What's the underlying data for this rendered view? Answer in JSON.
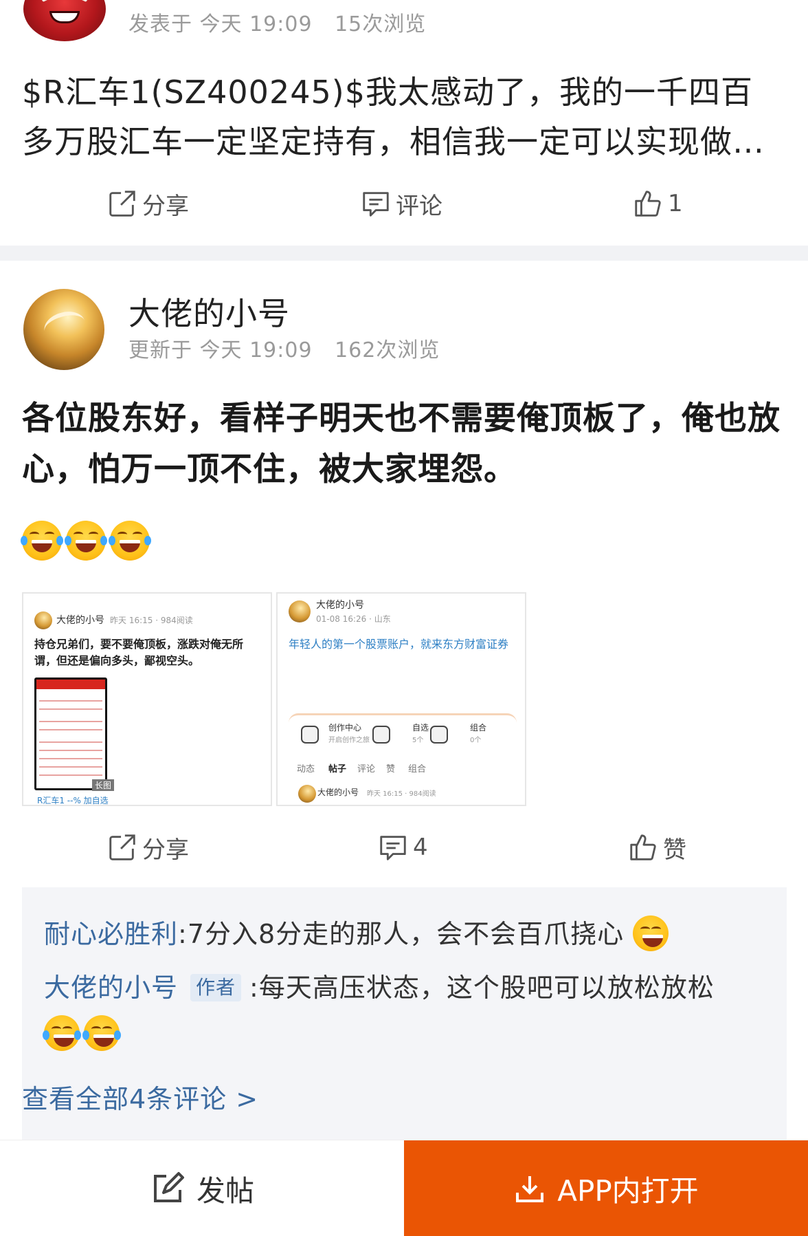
{
  "post1": {
    "meta_time": "发表于 今天 19:09",
    "meta_views": "15次浏览",
    "content": "$R汇车1(SZ400245)$我太感动了，我的一千四百多万股汇车一定坚定持有，相信我一定可以实现做多的梦想",
    "actions": {
      "share": "分享",
      "comment": "评论",
      "like_count": "1"
    }
  },
  "post2": {
    "author": "大佬的小号",
    "meta_time": "更新于 今天 19:09",
    "meta_views": "162次浏览",
    "content": "各位股东好，看样子明天也不需要俺顶板了，俺也放心，怕万一顶不住，被大家埋怨。",
    "emoji_count": 3,
    "thumbnails": [
      {
        "name": "大佬的小号",
        "meta": "昨天 16:15 · 984阅读",
        "text": "持仓兄弟们，要不要俺顶板，涨跌对俺无所谓，但还是偏向多头，鄙视空头。",
        "badge": "长图",
        "footer": "R汇车1 --% 加自选"
      },
      {
        "name": "大佬的小号",
        "meta": "01-08 16:26 · 山东",
        "text": "年轻人的第一个股票账户，就来东方财富证券",
        "cards": [
          {
            "title": "创作中心",
            "sub": "开启创作之旅"
          },
          {
            "title": "自选",
            "sub": "5个"
          },
          {
            "title": "组合",
            "sub": "0个"
          }
        ],
        "tabs": [
          "动态",
          "帖子",
          "评论",
          "赞",
          "组合"
        ],
        "footer_name": "大佬的小号",
        "footer_meta": "昨天 16:15 · 984阅读"
      }
    ],
    "actions": {
      "share": "分享",
      "comment_count": "4",
      "like": "赞"
    },
    "replies": [
      {
        "name": "耐心必胜利",
        "text": ":7分入8分走的那人，会不会百爪挠心"
      },
      {
        "name": "大佬的小号",
        "tag": "作者",
        "text": ":每天高压状态，这个股吧可以放松放松"
      }
    ],
    "view_all": "查看全部4条评论 >"
  },
  "bottom_bar": {
    "post_label": "发帖",
    "app_label": "APP内打开",
    "app_color": "#ea5504"
  },
  "colors": {
    "link_blue": "#3b6aa0",
    "meta_gray": "#9a9a9a"
  }
}
